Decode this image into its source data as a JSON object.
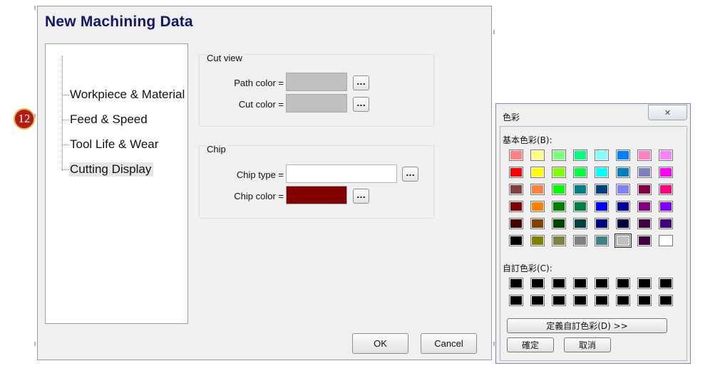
{
  "dialog": {
    "title": "New Machining Data",
    "tree": [
      {
        "label": "Workpiece & Material"
      },
      {
        "label": "Feed & Speed"
      },
      {
        "label": "Tool Life & Wear"
      },
      {
        "label": "Cutting Display",
        "selected": true
      }
    ],
    "cut_view": {
      "title": "Cut view",
      "path_color_label": "Path color =",
      "path_color": "#c0c0c0",
      "cut_color_label": "Cut color =",
      "cut_color": "#c0c0c0"
    },
    "chip": {
      "title": "Chip",
      "chip_type_label": "Chip type =",
      "chip_type_value": "",
      "chip_color_label": "Chip color =",
      "chip_color": "#800000"
    },
    "ellipsis_label": "...",
    "ok_label": "OK",
    "cancel_label": "Cancel"
  },
  "step_badge": "12",
  "color_dialog": {
    "title": "色彩",
    "close_label": "✕",
    "basic_label": "基本色彩(B):",
    "basic_colors": [
      "#ff8080",
      "#ffff80",
      "#80ff80",
      "#00ff80",
      "#80ffff",
      "#0080ff",
      "#ff80c0",
      "#ff80ff",
      "#ff0000",
      "#ffff00",
      "#80ff00",
      "#00ff40",
      "#00ffff",
      "#0080c0",
      "#8080c0",
      "#ff00ff",
      "#804040",
      "#ff8040",
      "#00ff00",
      "#008080",
      "#004080",
      "#8080ff",
      "#800040",
      "#ff0080",
      "#800000",
      "#ff8000",
      "#008000",
      "#008040",
      "#0000ff",
      "#0000a0",
      "#800080",
      "#8000ff",
      "#400000",
      "#804000",
      "#004000",
      "#004040",
      "#000080",
      "#000040",
      "#400040",
      "#400080",
      "#000000",
      "#808000",
      "#808040",
      "#808080",
      "#408080",
      "#c0c0c0",
      "#400040",
      "#ffffff"
    ],
    "selected_index": 45,
    "custom_label": "自訂色彩(C):",
    "custom_colors": [
      "#000000",
      "#000000",
      "#000000",
      "#000000",
      "#000000",
      "#000000",
      "#000000",
      "#000000",
      "#000000",
      "#000000",
      "#000000",
      "#000000",
      "#000000",
      "#000000",
      "#000000",
      "#000000"
    ],
    "define_label": "定義自訂色彩(D) >>",
    "ok_label": "確定",
    "cancel_label": "取消"
  }
}
